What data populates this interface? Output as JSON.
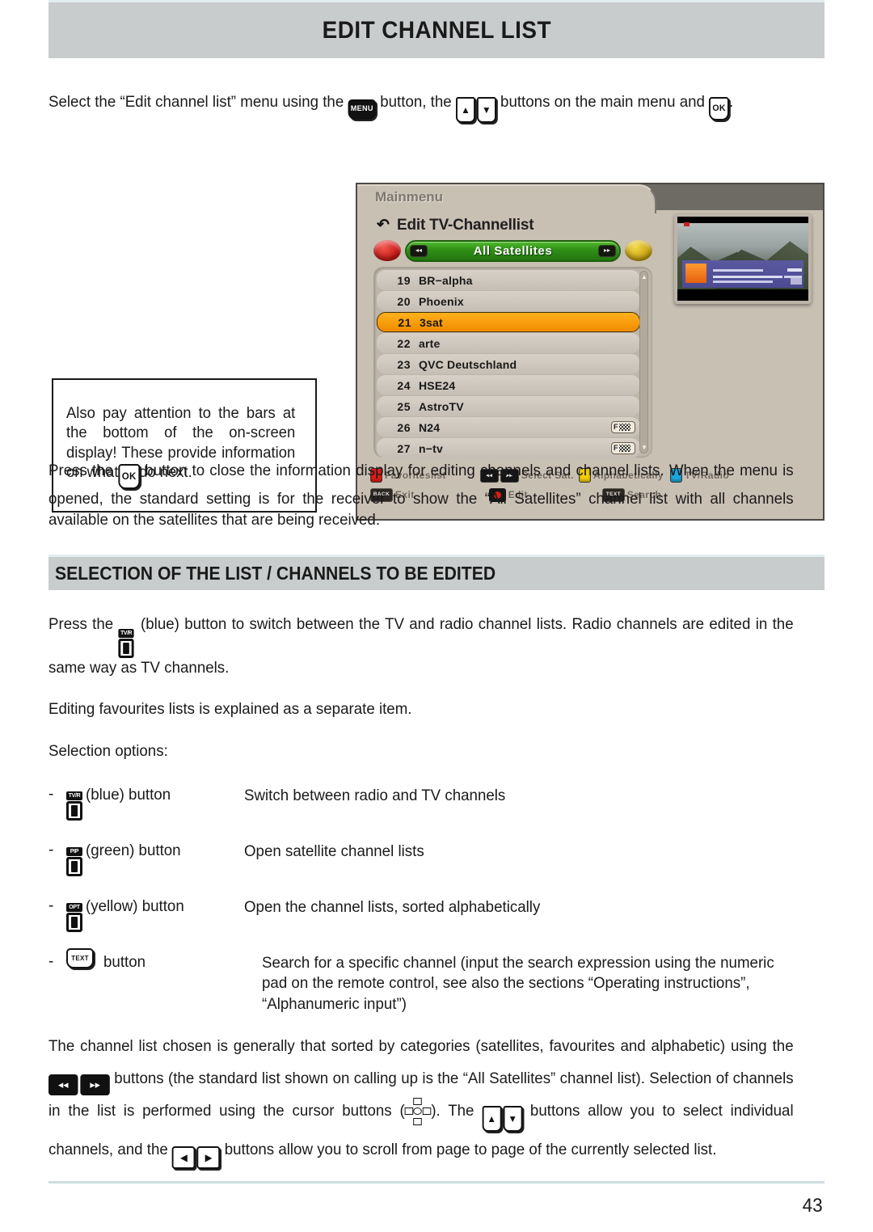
{
  "header": {
    "title": "EDIT CHANNEL LIST"
  },
  "intro": {
    "a": "Select the “Edit channel list” menu using the",
    "b": "button, the",
    "c": "buttons on the main menu and",
    "d": "."
  },
  "keys": {
    "menu": "MENU",
    "ok": "OK",
    "text": "TEXT",
    "up": "▲",
    "down": "▼",
    "left": "◀",
    "right": "▶",
    "rewind": "◂◂",
    "forward": "▸▸",
    "tvr": "TV/R",
    "pip": "PIP",
    "opt": "OPT",
    "back": "BACK"
  },
  "callout": {
    "text": "Also pay attention to the bars at the bottom of the on-screen display! These provide information on what to do next."
  },
  "osd": {
    "breadcrumb": "Mainmenu",
    "back_icon": "↶",
    "title": "Edit TV-Channellist",
    "nav": {
      "label": "All Satellites",
      "left_icon": "◂◂",
      "right_icon": "▸▸",
      "red_dot": "red-circle",
      "yellow_dot": "yellow-circle"
    },
    "channels": [
      {
        "num": "19",
        "name": "BR−alpha",
        "encrypted": false
      },
      {
        "num": "20",
        "name": "Phoenix",
        "encrypted": false
      },
      {
        "num": "21",
        "name": "3sat",
        "encrypted": false,
        "selected": true
      },
      {
        "num": "22",
        "name": "arte",
        "encrypted": false
      },
      {
        "num": "23",
        "name": "QVC Deutschland",
        "encrypted": false
      },
      {
        "num": "24",
        "name": "HSE24",
        "encrypted": false
      },
      {
        "num": "25",
        "name": "AstroTV",
        "encrypted": false
      },
      {
        "num": "26",
        "name": "N24",
        "encrypted": true
      },
      {
        "num": "27",
        "name": "n−tv",
        "encrypted": true
      }
    ],
    "enc_label": "F",
    "scroll_up": "▲",
    "scroll_down": "▼",
    "hints_row1": [
      {
        "type": "sq-red",
        "label": "Favoriteslist"
      },
      {
        "type": "blk2",
        "label": "Select Sat."
      },
      {
        "type": "sq-yellow",
        "label": "Alphabetically"
      },
      {
        "type": "sq-blue",
        "label": "TV/Radio"
      }
    ],
    "hints_row2": [
      {
        "type": "back",
        "label": "Exit"
      },
      {
        "type": "recdot",
        "label": "Edit"
      },
      {
        "type": "text",
        "label": "Search"
      }
    ],
    "colors": {
      "red": "#e01b14",
      "yellow": "#f2cd08",
      "blue": "#1ba6dd",
      "green_bar": "#2f8f17",
      "selected_row": "#f5a111",
      "panel": "#c9c0b4"
    }
  },
  "para_ok": {
    "a": "Press the",
    "b": "button to close the information display for editing channels and channel lists. When the menu is opened, the standard setting is for the receiver to show the “All Satellites” channel list with all channels available on the satellites that are being received."
  },
  "section2": {
    "title": "SELECTION OF THE LIST / CHANNELS TO BE EDITED"
  },
  "para_blue": {
    "a": "Press the",
    "b": "(blue) button to switch between the TV and radio channel lists. Radio channels are edited in the same way as TV channels."
  },
  "para_fav": "Editing favourites lists is explained as a separate item.",
  "selection_options_label": "Selection options:",
  "options": [
    {
      "dash": "-",
      "key": "TV/R",
      "name": "(blue) button",
      "desc": "Switch between radio and TV channels"
    },
    {
      "dash": "-",
      "key": "PIP",
      "name": "(green) button",
      "desc": "Open satellite channel lists"
    },
    {
      "dash": "-",
      "key": "OPT",
      "name": "(yellow) button",
      "desc": "Open the channel lists, sorted alphabetically"
    },
    {
      "dash": "-",
      "key": "TEXT",
      "name": "button",
      "desc": "Search for a specific channel (input the search expression using the numeric pad on the remote control, see also the sections “Operating instructions”, “Alphanumeric input”)"
    }
  ],
  "para_final": {
    "a": "The channel list chosen is generally that sorted by categories (satellites, favourites and alphabetic) using",
    "b": "the",
    "c": "buttons (the standard list shown on calling up is the “All Satellites” channel list). Selection",
    "d": "of channels in the list is performed using the cursor buttons (",
    "e": "). The",
    "f": "buttons allow you to",
    "g": "select individual channels, and the",
    "h": "buttons allow you to scroll from page to page of the currently selected list."
  },
  "footer": {
    "page_number": "43"
  }
}
